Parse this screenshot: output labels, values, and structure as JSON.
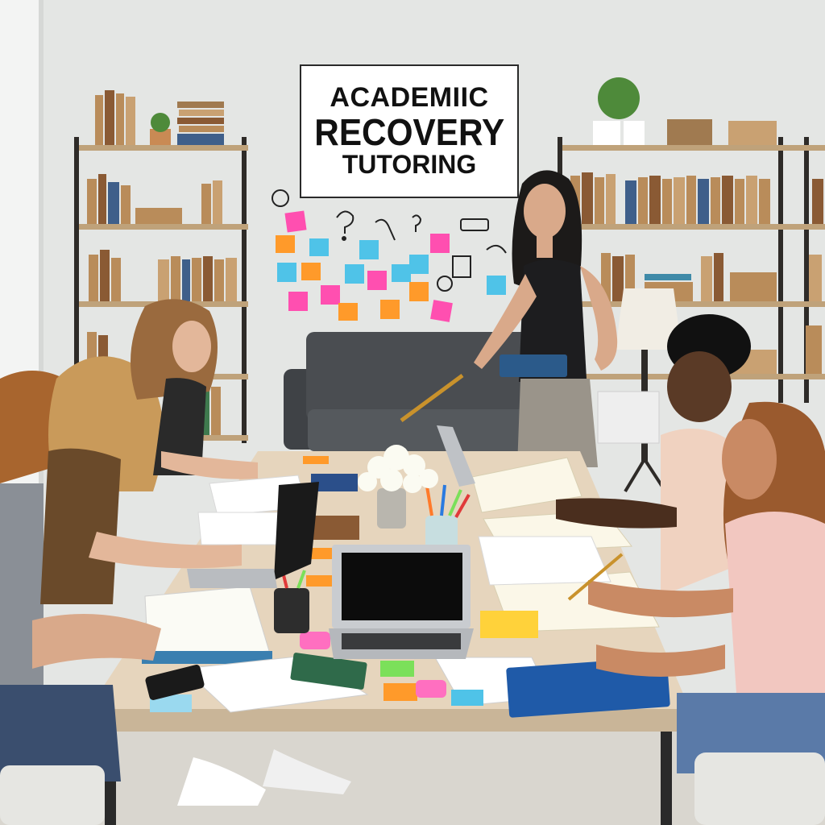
{
  "sign": {
    "line1": "ACADEMIIC",
    "line2": "RECOVERY",
    "line3": "TUTORING"
  },
  "colors": {
    "wall": "#e4e6e4",
    "shelf": "#2e2b28",
    "table": "#e6d5bd",
    "sofa": "#4a4d51",
    "sticky_pink": "#ff4fb0",
    "sticky_orange": "#ff9a2a",
    "sticky_blue": "#4fc3e8",
    "sticky_green": "#7be05a"
  }
}
